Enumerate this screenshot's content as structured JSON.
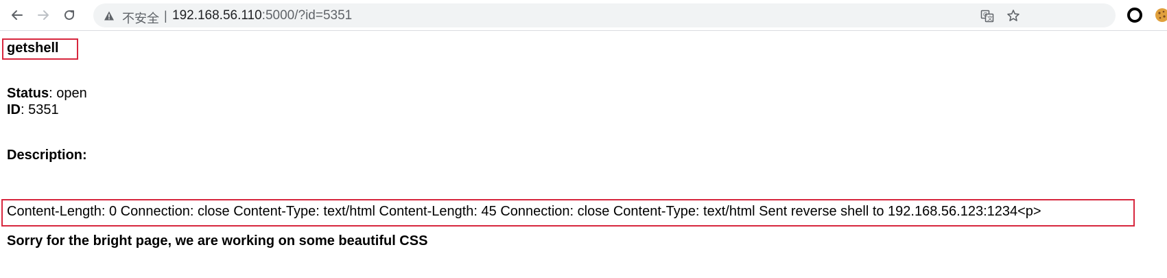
{
  "browser": {
    "security_label": "不安全",
    "separator": "|",
    "url_host": "192.168.56.110",
    "url_rest": ":5000/?id=5351",
    "icons": {
      "back": "back-arrow-icon",
      "forward": "forward-arrow-icon",
      "reload": "reload-icon",
      "warning": "warning-triangle-icon",
      "translate": "translate-icon",
      "bookmark": "star-icon",
      "extension1": "ring-extension-icon",
      "extension2": "cookie-extension-icon"
    }
  },
  "page": {
    "title": "getshell",
    "status_label": "Status",
    "status_value": ": open",
    "id_label": "ID",
    "id_value": ": 5351",
    "description_label": "Description:",
    "output_text": "Content-Length: 0 Connection: close Content-Type: text/html Content-Length: 45 Connection: close Content-Type: text/html Sent reverse shell to 192.168.56.123:1234<p>",
    "footer_note": "Sorry for the bright page, we are working on some beautiful CSS"
  },
  "colors": {
    "highlight_box": "#d7263d",
    "omnibox_bg": "#f1f3f4",
    "chrome_icon": "#5f6368"
  }
}
